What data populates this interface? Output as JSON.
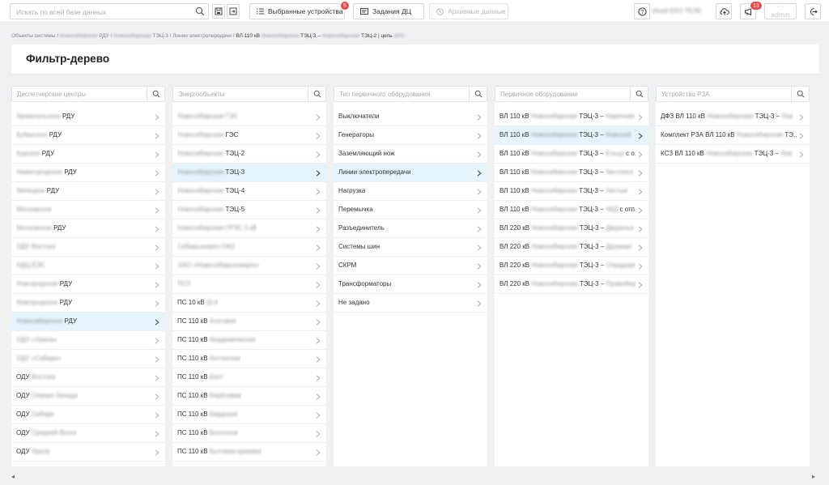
{
  "header": {
    "search_placeholder": "Искать по всей базе данных",
    "favorites_label": "Выбранные устройства",
    "favorites_badge": "5",
    "tasks_label": "Задания ДЦ",
    "archive_label": "Архивные данные",
    "notifications_badge": "13",
    "username": "Иной ЕКО ТЕЛЕ",
    "user_dots": "···",
    "user_role": "admin"
  },
  "breadcrumb": {
    "p1": "Объекты системы",
    "p2": "Новосибирское",
    "p2b": "РДУ",
    "p3": "Новосибирская",
    "p3b": "ТЭЦ-3",
    "p4": "Линии электропередачи",
    "p5": "ВЛ 110 кВ",
    "p5b": "Новосибирская",
    "p5c": "ТЭЦ-3 –",
    "p5d": "Новосибирская",
    "p5e": "ТЭЦ-2 | цепь",
    "p5f": "(ВЛ)",
    "sep": " / "
  },
  "page_title": "Фильтр-дерево",
  "columns": [
    {
      "header": "Диспетчерские центры",
      "items": [
        {
          "blur": "Архангельское",
          "text": " РДУ",
          "sel": false
        },
        {
          "blur": "Кубанское",
          "text": " РДУ",
          "sel": false
        },
        {
          "blur": "Курское",
          "text": " РДУ",
          "sel": false
        },
        {
          "blur": "Нижегородское",
          "text": " РДУ",
          "sel": false
        },
        {
          "blur": "Липецкое",
          "text": " РДУ",
          "sel": false
        },
        {
          "blur": "Московское",
          "text": "",
          "sel": false
        },
        {
          "blur": "Московское",
          "text": " РДУ",
          "sel": false
        },
        {
          "blur": "ОДУ Востока",
          "text": "",
          "sel": false
        },
        {
          "blur": "НДЦ ЕЭС",
          "text": "",
          "sel": false
        },
        {
          "blur": "Новгородское",
          "text": " РДУ",
          "sel": false
        },
        {
          "blur": "Новгородское",
          "text": " РДУ",
          "sel": false
        },
        {
          "blur": "Новосибирское",
          "text": " РДУ",
          "sel": true
        },
        {
          "blur": "ОДУ «Урала»",
          "text": "",
          "sel": false
        },
        {
          "blur": "ОДУ «Сибири»",
          "text": "",
          "sel": false
        },
        {
          "blur": "",
          "text": "ОДУ ",
          "tail": "Востока",
          "sel": false
        },
        {
          "blur": "",
          "text": "ОДУ ",
          "tail": "Северо-Запада",
          "sel": false
        },
        {
          "blur": "",
          "text": "ОДУ ",
          "tail": "Сибири",
          "sel": false
        },
        {
          "blur": "",
          "text": "ОДУ ",
          "tail": "Средней Волги",
          "sel": false
        },
        {
          "blur": "",
          "text": "ОДУ ",
          "tail": "Урала",
          "sel": false
        }
      ]
    },
    {
      "header": "Энергообъекты",
      "items": [
        {
          "blur": "Новосибирская ГЭС",
          "text": "",
          "sel": false
        },
        {
          "blur": "Новосибирская",
          "text": " ГЭС",
          "sel": false
        },
        {
          "blur": "Новосибирская",
          "text": " ТЭЦ-2",
          "sel": false
        },
        {
          "blur": "Новосибирская",
          "text": " ТЭЦ-3",
          "sel": true
        },
        {
          "blur": "Новосибирская",
          "text": " ТЭЦ-4",
          "sel": false
        },
        {
          "blur": "Новосибирская",
          "text": " ТЭЦ-5",
          "sel": false
        },
        {
          "blur": "Новосибирская ГРЭС 5 кВ",
          "text": "",
          "sel": false
        },
        {
          "blur": "Сибирьэнерго ОАО",
          "text": "",
          "sel": false
        },
        {
          "blur": "ОАО «Новосибирскэнерго»",
          "text": "",
          "sel": false
        },
        {
          "blur": "ПСП",
          "text": "",
          "sel": false
        },
        {
          "blur": "",
          "text": "ПС 10 кВ ",
          "tail": "Ш-4",
          "sel": false
        },
        {
          "blur": "",
          "text": "ПС 110 кВ ",
          "tail": "Агатовая",
          "sel": false
        },
        {
          "blur": "",
          "text": "ПС 110 кВ ",
          "tail": "Академическая",
          "sel": false
        },
        {
          "blur": "",
          "text": "ПС 110 кВ ",
          "tail": "Антонская",
          "sel": false
        },
        {
          "blur": "",
          "text": "ПС 110 кВ ",
          "tail": "Бахт",
          "sel": false
        },
        {
          "blur": "",
          "text": "ПС 110 кВ ",
          "tail": "Берёзовая",
          "sel": false
        },
        {
          "blur": "",
          "text": "ПС 110 кВ ",
          "tail": "Бердская",
          "sel": false
        },
        {
          "blur": "",
          "text": "ПС 110 кВ ",
          "tail": "Болотное",
          "sel": false
        },
        {
          "blur": "",
          "text": "ПС 110 кВ ",
          "tail": "Бытовая-краевая",
          "sel": false
        }
      ]
    },
    {
      "header": "Тип первичного оборудования",
      "items": [
        {
          "blur": "",
          "text": "Выключатели",
          "sel": false
        },
        {
          "blur": "",
          "text": "Генераторы",
          "sel": false
        },
        {
          "blur": "",
          "text": "Заземляющий нож",
          "sel": false
        },
        {
          "blur": "",
          "text": "Линии электропередачи",
          "sel": true
        },
        {
          "blur": "",
          "text": "Нагрузка",
          "sel": false
        },
        {
          "blur": "",
          "text": "Перемычка",
          "sel": false
        },
        {
          "blur": "",
          "text": "Разъединитель",
          "sel": false
        },
        {
          "blur": "",
          "text": "Системы шин",
          "sel": false
        },
        {
          "blur": "",
          "text": "СКРМ",
          "sel": false
        },
        {
          "blur": "",
          "text": "Трансформаторы",
          "sel": false
        },
        {
          "blur": "",
          "text": "Не задано",
          "sel": false
        }
      ]
    },
    {
      "header": "Первичное оборудование",
      "items": [
        {
          "blur": "",
          "text": "ВЛ 110 кВ ",
          "tail": "Новосибирская",
          "rest": " ТЭЦ-3 – ",
          "tail2": "Наречная",
          "sel": false
        },
        {
          "blur": "",
          "text": "ВЛ 110 кВ ",
          "tail": "Новосибирская",
          "rest": " ТЭЦ-3 – ",
          "tail2": "Новосиб",
          "sel": true
        },
        {
          "blur": "",
          "text": "ВЛ 110 кВ ",
          "tail": "Новосибирская",
          "rest": " ТЭЦ-3 – ",
          "tail2": "Ельцо",
          "rest2": " с о...",
          "sel": false
        },
        {
          "blur": "",
          "text": "ВЛ 110 кВ ",
          "tail": "Новосибирская",
          "rest": " ТЭЦ-3 – ",
          "tail2": "Чистопол",
          "sel": false
        },
        {
          "blur": "",
          "text": "ВЛ 110 кВ ",
          "tail": "Новосибирская",
          "rest": " ТЭЦ-3 – ",
          "tail2": "Чистые",
          "sel": false
        },
        {
          "blur": "",
          "text": "ВЛ 110 кВ ",
          "tail": "Новосибирская",
          "rest": " ТЭЦ-3 – ",
          "tail2": "ЧКД",
          "rest2": " с отп...",
          "sel": false
        },
        {
          "blur": "",
          "text": "ВЛ 220 кВ ",
          "tail": "Новосибирская",
          "rest": " ТЭЦ-3 – ",
          "tail2": "Двуречье",
          "sel": false
        },
        {
          "blur": "",
          "text": "ВЛ 220 кВ ",
          "tail": "Новосибирская",
          "rest": " ТЭЦ-3 – ",
          "tail2": "Дружная",
          "sel": false
        },
        {
          "blur": "",
          "text": "ВЛ 220 кВ ",
          "tail": "Новосибирская",
          "rest": " ТЭЦ-3 – ",
          "tail2": "Отрадная",
          "sel": false
        },
        {
          "blur": "",
          "text": "ВЛ 220 кВ ",
          "tail": "Новосибирская",
          "rest": " ТЭЦ-3 – ",
          "tail2": "Правобере",
          "sel": false
        }
      ]
    },
    {
      "header": "Устройство РЗА",
      "items": [
        {
          "blur": "",
          "text": "ДФЗ ВЛ 110 кВ ",
          "tail": "Новосибирская",
          "rest": " ТЭЦ-3 – ",
          "tail2": "Нов",
          "sel": false
        },
        {
          "blur": "",
          "text": "Комплект РЗА ВЛ 110 кВ ",
          "tail": "Новосибирская",
          "rest": " ТЭ...",
          "sel": false
        },
        {
          "blur": "",
          "text": "КСЗ ВЛ 110 кВ ",
          "tail": "Новосибирская",
          "rest": " ТЭЦ-3 – ",
          "tail2": "Нов",
          "sel": false
        }
      ]
    }
  ]
}
